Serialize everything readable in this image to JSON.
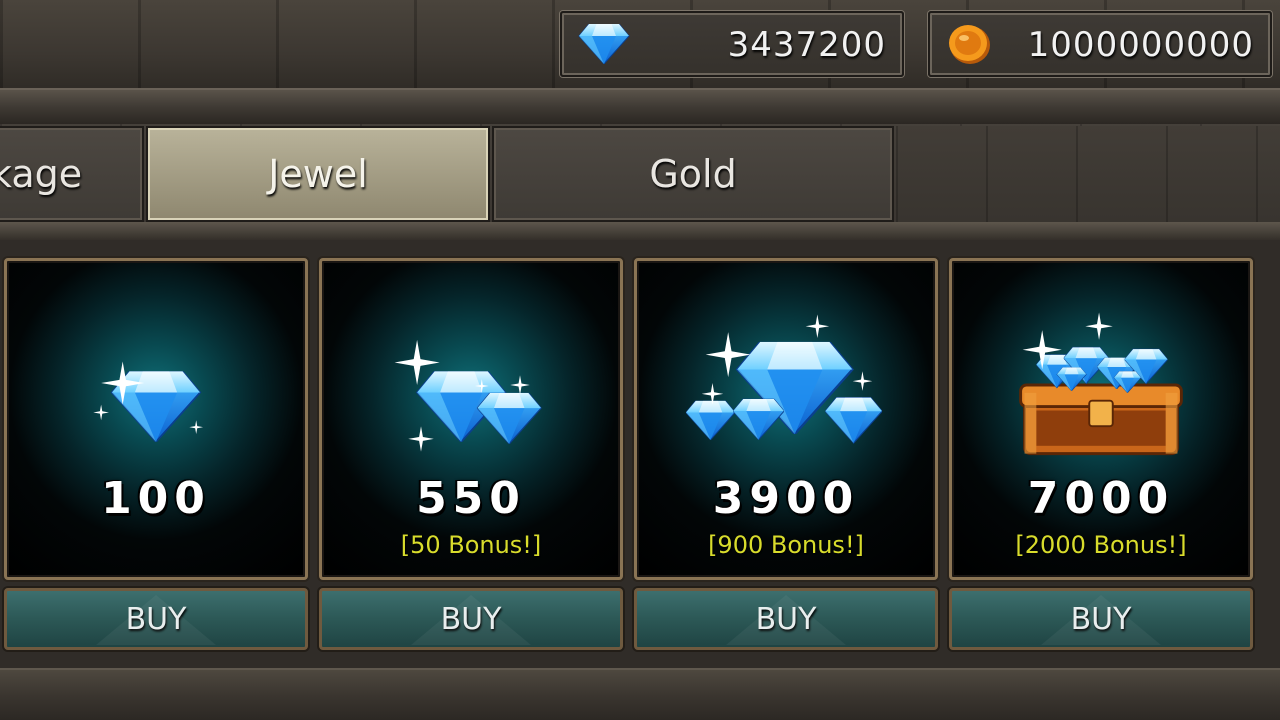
{
  "currency": {
    "gems": {
      "icon": "diamond-icon",
      "value": "3437200"
    },
    "gold": {
      "icon": "gold-coin-icon",
      "value": "1000000000"
    }
  },
  "tabs": [
    {
      "label": "kage",
      "active": false
    },
    {
      "label": "Jewel",
      "active": true
    },
    {
      "label": "Gold",
      "active": false
    }
  ],
  "items": [
    {
      "amount": "100",
      "bonus": "",
      "buy": "BUY",
      "icon": "single-diamond-icon"
    },
    {
      "amount": "550",
      "bonus": "[50 Bonus!]",
      "buy": "BUY",
      "icon": "two-diamonds-icon"
    },
    {
      "amount": "3900",
      "bonus": "[900 Bonus!]",
      "buy": "BUY",
      "icon": "diamond-pile-icon"
    },
    {
      "amount": "7000",
      "bonus": "[2000 Bonus!]",
      "buy": "BUY",
      "icon": "diamond-chest-icon"
    }
  ],
  "colors": {
    "bonus_text": "#d8dc2c",
    "buy_button": "#2c5856",
    "active_tab": "#b9b39a",
    "gem_blue": "#2fb6ff"
  }
}
